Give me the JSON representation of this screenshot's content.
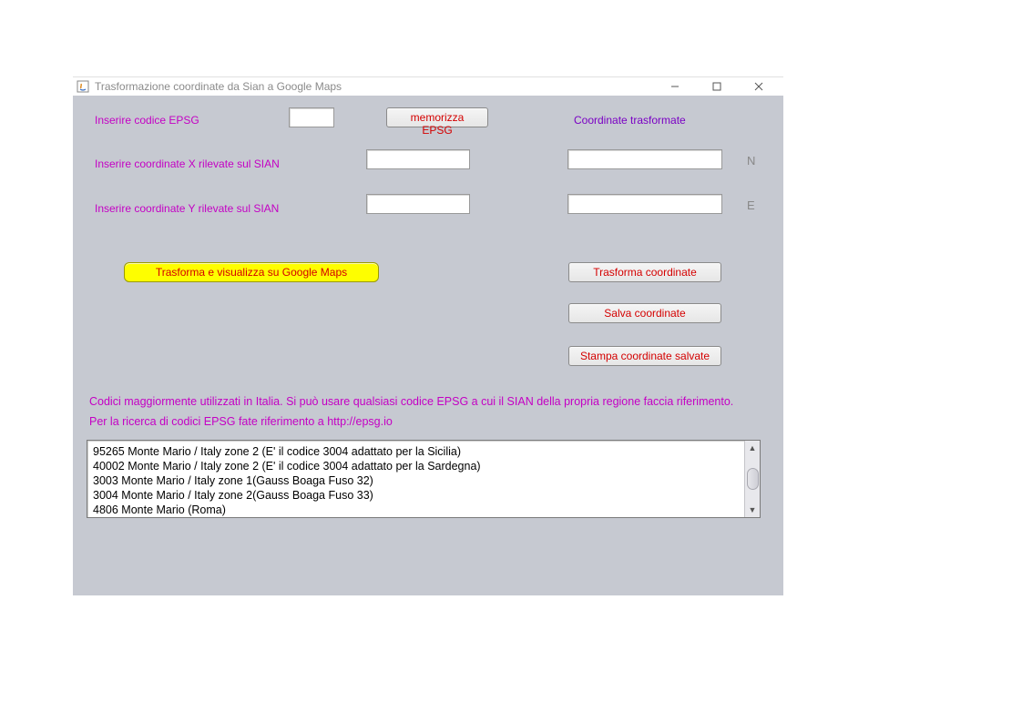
{
  "window": {
    "title": "Trasformazione coordinate da Sian a Google Maps"
  },
  "labels": {
    "epsg": "Inserire codice EPSG",
    "coordX": "Inserire coordinate X rilevate sul SIAN",
    "coordY": "Inserire coordinate Y rilevate sul SIAN",
    "coordTransformed": "Coordinate trasformate",
    "north": "N",
    "east": "E"
  },
  "buttons": {
    "memorizza": "memorizza EPSG",
    "trasformaVisualizza": "Trasforma e visualizza su Google Maps",
    "trasforma": "Trasforma coordinate",
    "salva": "Salva coordinate",
    "stampa": "Stampa coordinate salvate"
  },
  "info": {
    "line1": "Codici maggiormente utilizzati in Italia. Si può usare qualsiasi codice EPSG a cui il SIAN della propria regione faccia riferimento.",
    "line2a": "Per la ricerca di codici EPSG fate riferimento a  ",
    "line2link": "http://epsg.io"
  },
  "codes": [
    "95265 Monte Mario / Italy zone 2 (E' il codice 3004 adattato per la Sicilia)",
    "40002 Monte Mario / Italy zone 2 (E' il codice 3004 adattato per la Sardegna)",
    "3003 Monte Mario / Italy zone 1(Gauss Boaga Fuso 32)",
    "3004 Monte Mario / Italy zone 2(Gauss Boaga Fuso 33)",
    "4806 Monte Mario (Roma)"
  ],
  "inputs": {
    "epsg": "",
    "x": "",
    "y": "",
    "outN": "",
    "outE": ""
  }
}
